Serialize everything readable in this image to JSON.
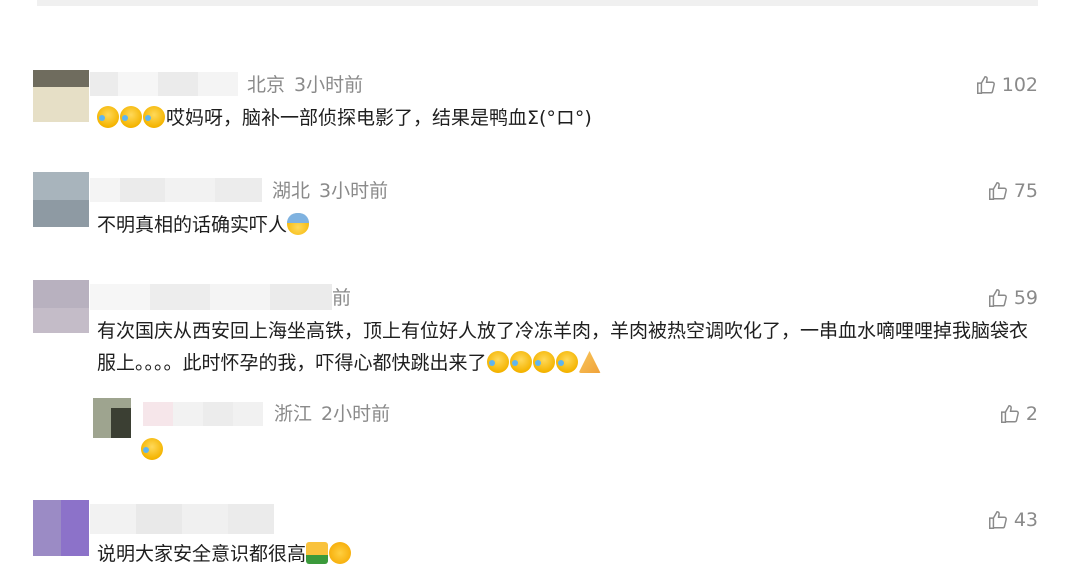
{
  "comments": [
    {
      "location": "北京",
      "time": "3小时前",
      "likes": "102",
      "text": "哎妈呀，脑补一部侦探电影了，结果是鸭血Σ(°ロ°)",
      "emoji_before": [
        "laugh-cry-emoji",
        "laugh-cry-emoji",
        "laugh-cry-emoji"
      ]
    },
    {
      "location": "湖北",
      "time": "3小时前",
      "likes": "75",
      "text": "不明真相的话确实吓人",
      "emoji_after": [
        "fearful-face-emoji"
      ]
    },
    {
      "location": "",
      "time": "前",
      "likes": "59",
      "text": "有次国庆从西安回上海坐高铁，顶上有位好人放了冷冻羊肉，羊肉被热空调吹化了，一串血水嘀哩哩掉我脑袋衣服上。。。。此时怀孕的我，吓得心都快跳出来了",
      "emoji_after": [
        "laugh-cry-emoji",
        "laugh-cry-emoji",
        "laugh-cry-emoji",
        "laugh-cry-emoji",
        "pray-emoji"
      ]
    },
    {
      "location": "浙江",
      "time": "2小时前",
      "likes": "2",
      "text": "",
      "emoji_after": [
        "laugh-cry-emoji"
      ],
      "is_reply": true
    },
    {
      "location": "",
      "time": "",
      "likes": "43",
      "text": "说明大家安全意识都很高",
      "emoji_after": [
        "thumbs-up-emoji",
        "hug-emoji"
      ]
    }
  ],
  "colors": {
    "meta": "#8a8a8a",
    "text": "#1e1e1e",
    "divider": "#f0f0f0"
  }
}
